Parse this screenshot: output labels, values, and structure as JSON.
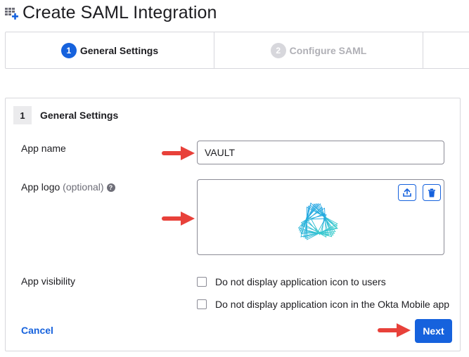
{
  "page": {
    "title": "Create SAML Integration",
    "icon": "app-grid-plus-icon"
  },
  "steps": [
    {
      "number": "1",
      "label": "General Settings",
      "state": "active"
    },
    {
      "number": "2",
      "label": "Configure SAML",
      "state": "inactive"
    }
  ],
  "section": {
    "number": "1",
    "title": "General Settings"
  },
  "form": {
    "app_name": {
      "label": "App name",
      "value": "VAULT"
    },
    "app_logo": {
      "label": "App logo",
      "optional": "(optional)",
      "help_icon": "question-circle-icon",
      "upload_icon": "upload-icon",
      "delete_icon": "trash-icon"
    },
    "app_visibility": {
      "label": "App visibility",
      "options": [
        {
          "label": "Do not display application icon to users",
          "checked": false
        },
        {
          "label": "Do not display application icon in the Okta Mobile app",
          "checked": false
        }
      ]
    }
  },
  "actions": {
    "cancel_label": "Cancel",
    "next_label": "Next"
  },
  "colors": {
    "primary": "#1662dd",
    "annotation_arrow": "#e8413a",
    "logo_gradient": [
      "#1a9be8",
      "#3ad0c8"
    ]
  }
}
